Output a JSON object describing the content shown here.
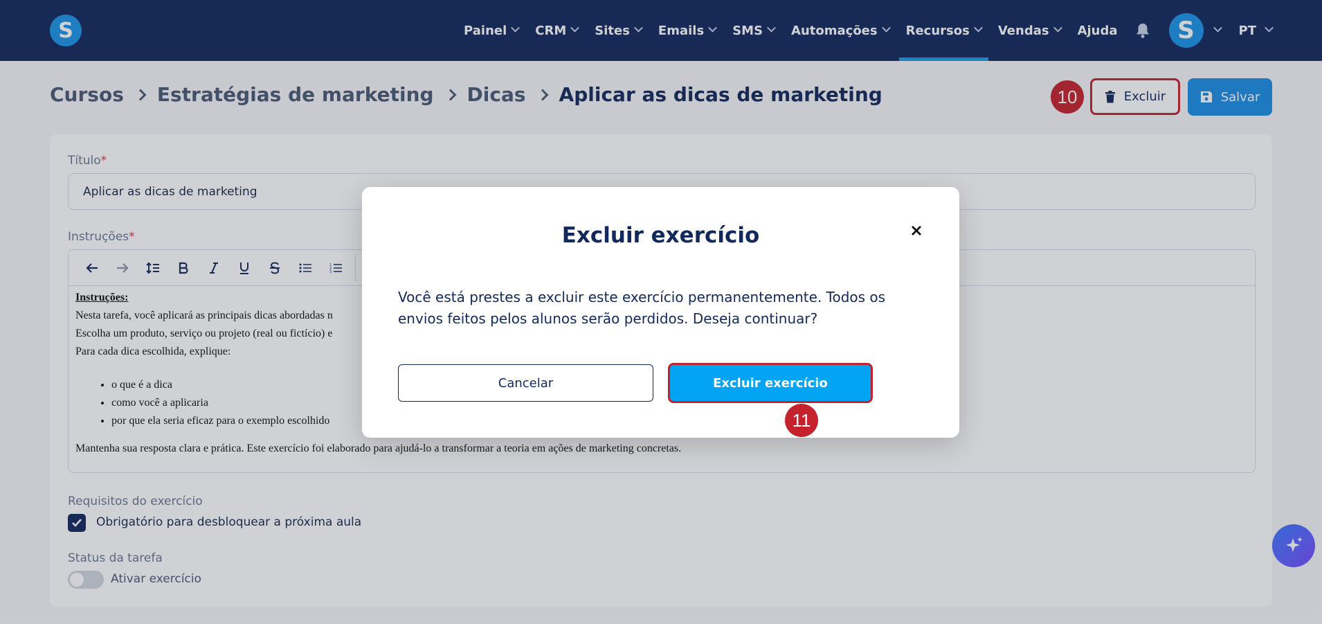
{
  "nav": {
    "logo_letter": "S",
    "items": [
      {
        "label": "Painel"
      },
      {
        "label": "CRM"
      },
      {
        "label": "Sites"
      },
      {
        "label": "Emails"
      },
      {
        "label": "SMS"
      },
      {
        "label": "Automações"
      },
      {
        "label": "Recursos"
      },
      {
        "label": "Vendas"
      },
      {
        "label": "Ajuda"
      }
    ],
    "active_item": "Recursos",
    "avatar_letter": "S",
    "language": "PT"
  },
  "breadcrumb": {
    "items": [
      "Cursos",
      "Estratégias de marketing",
      "Dicas"
    ],
    "current": "Aplicar as dicas de marketing"
  },
  "actions": {
    "delete_label": "Excluir",
    "save_label": "Salvar",
    "step_delete": "10",
    "step_confirm": "11"
  },
  "form": {
    "title_label": "Título",
    "required_mark": "*",
    "title_value": "Aplicar as dicas de marketing",
    "instructions_label": "Instruções",
    "editor": {
      "heading": "Instruções:",
      "line1": "Nesta tarefa, você aplicará as principais dicas abordadas n",
      "line2": "Escolha um produto, serviço ou projeto (real ou fictício) e",
      "line3": "Para cada dica escolhida, explique:",
      "bullets": [
        "o que é a dica",
        "como você a aplicaria",
        "por que ela seria eficaz para o exemplo escolhido"
      ],
      "closing": "Mantenha sua resposta clara e prática. Este exercício foi elaborado para ajudá-lo a transformar a teoria em ações de marketing concretas."
    },
    "requirements_label": "Requisitos do exercício",
    "requirement_checkbox": "Obrigatório para desbloquear a próxima aula",
    "requirement_checked": true,
    "status_label": "Status da tarefa",
    "status_toggle": "Ativar exercício",
    "status_active": false
  },
  "modal": {
    "title": "Excluir exercício",
    "body": "Você está prestes a excluir este exercício permanentemente. Todos os envios feitos pelos alunos serão perdidos. Deseja continuar?",
    "cancel_label": "Cancelar",
    "confirm_label": "Excluir exercício"
  },
  "colors": {
    "nav_bg": "#12295e",
    "accent": "#1c8fe6",
    "confirm_bg": "#04a4f4",
    "highlight": "#c4232e"
  },
  "icons": [
    "bell-icon",
    "trash-icon",
    "save-icon",
    "close-icon",
    "undo-icon",
    "redo-icon",
    "line-height-icon",
    "bold-icon",
    "italic-icon",
    "underline-icon",
    "strikethrough-icon",
    "bullet-list-icon",
    "numbered-list-icon",
    "check-icon",
    "sparkle-icon",
    "chevron-down-icon"
  ]
}
